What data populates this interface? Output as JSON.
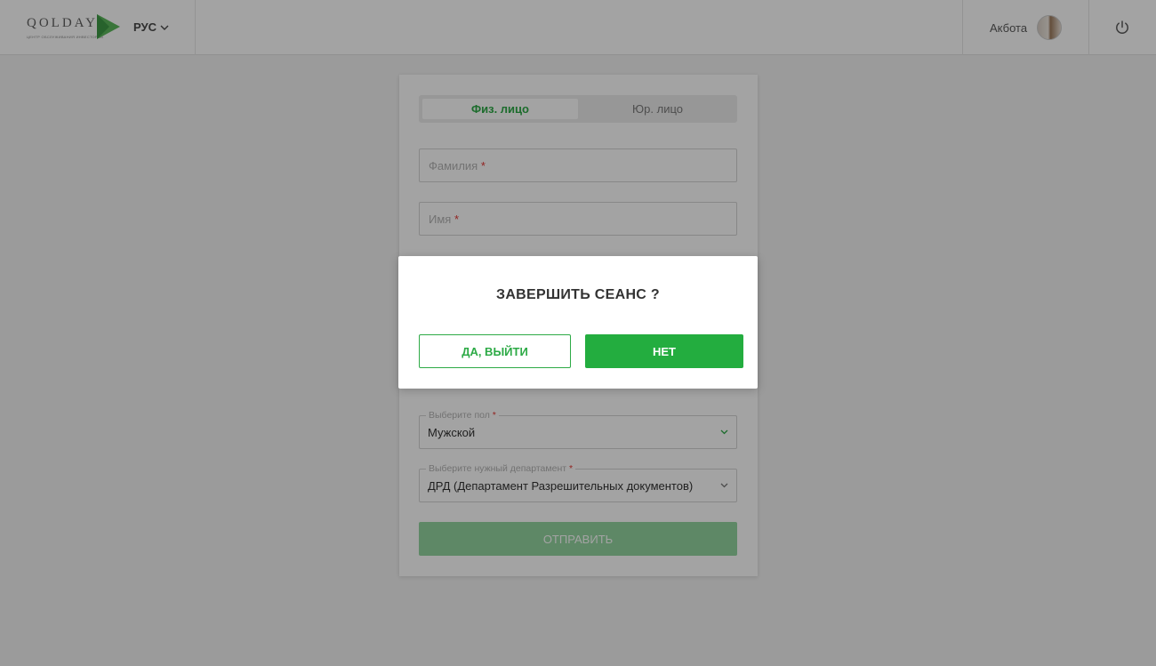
{
  "header": {
    "logo_text": "QOLDAY",
    "logo_subtitle": "ЦЕНТР ОБСЛУЖИВАНИЯ ИНВЕСТОРОВ",
    "language": "РУС",
    "user_name": "Акбота"
  },
  "form": {
    "tabs": [
      {
        "label": "Физ. лицо",
        "active": true
      },
      {
        "label": "Юр. лицо",
        "active": false
      }
    ],
    "surname_placeholder": "Фамилия",
    "name_placeholder": "Имя",
    "required_mark": "*",
    "gender": {
      "label": "Выберите пол",
      "value": "Мужской"
    },
    "department": {
      "label": "Выберите нужный департамент",
      "value": "ДРД (Департамент Разрешительных документов)"
    },
    "submit_label": "ОТПРАВИТЬ"
  },
  "modal": {
    "title": "ЗАВЕРШИТЬ СЕАНС ?",
    "confirm_label": "ДА, ВЫЙТИ",
    "cancel_label": "НЕТ"
  },
  "colors": {
    "accent": "#23ad3f",
    "accent_text": "#2daa46",
    "required": "#e53935",
    "submit_disabled": "#93d5a0"
  },
  "icons": {
    "logo": "triangle-logo-icon",
    "language_dropdown": "chevron-down-icon",
    "power": "power-icon",
    "select_chevron": "chevron-down-icon"
  }
}
